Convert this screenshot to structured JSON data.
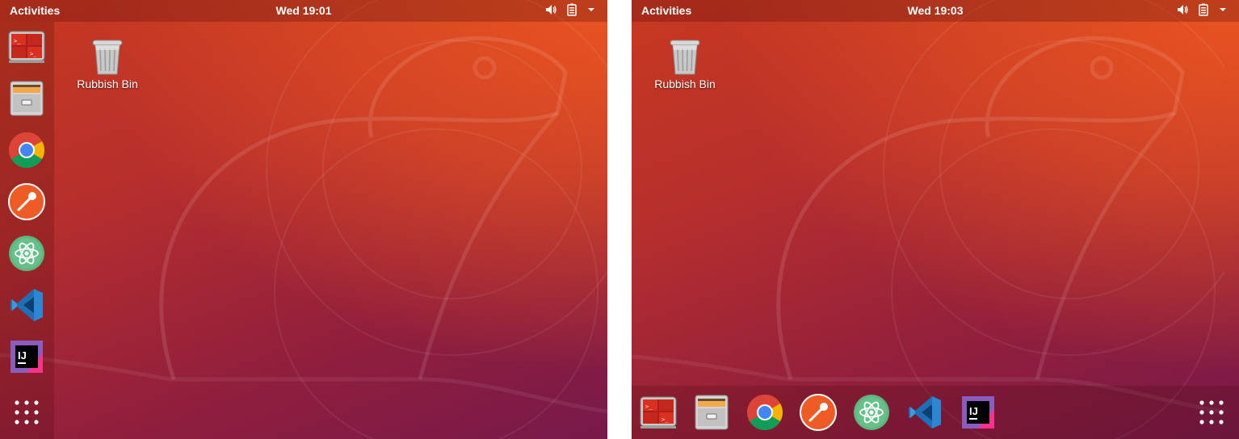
{
  "left_screen": {
    "topbar": {
      "activities": "Activities",
      "clock": "Wed 19:01"
    },
    "desktop": {
      "trash_label": "Rubbish Bin"
    },
    "dock": {
      "orientation": "left",
      "apps": [
        "terminal-icon",
        "file-cabinet-icon",
        "chrome-icon",
        "postman-icon",
        "atom-icon",
        "vscode-icon",
        "intellij-icon"
      ],
      "show_apps": "app-grid-icon"
    }
  },
  "right_screen": {
    "topbar": {
      "activities": "Activities",
      "clock": "Wed 19:03"
    },
    "desktop": {
      "trash_label": "Rubbish Bin"
    },
    "dock": {
      "orientation": "bottom",
      "apps": [
        "terminal-icon",
        "file-cabinet-icon",
        "chrome-icon",
        "postman-icon",
        "atom-icon",
        "vscode-icon",
        "intellij-icon"
      ],
      "show_apps": "app-grid-icon"
    }
  },
  "colors": {
    "ubuntu_orange": "#e95420",
    "aubergine": "#77194a"
  }
}
